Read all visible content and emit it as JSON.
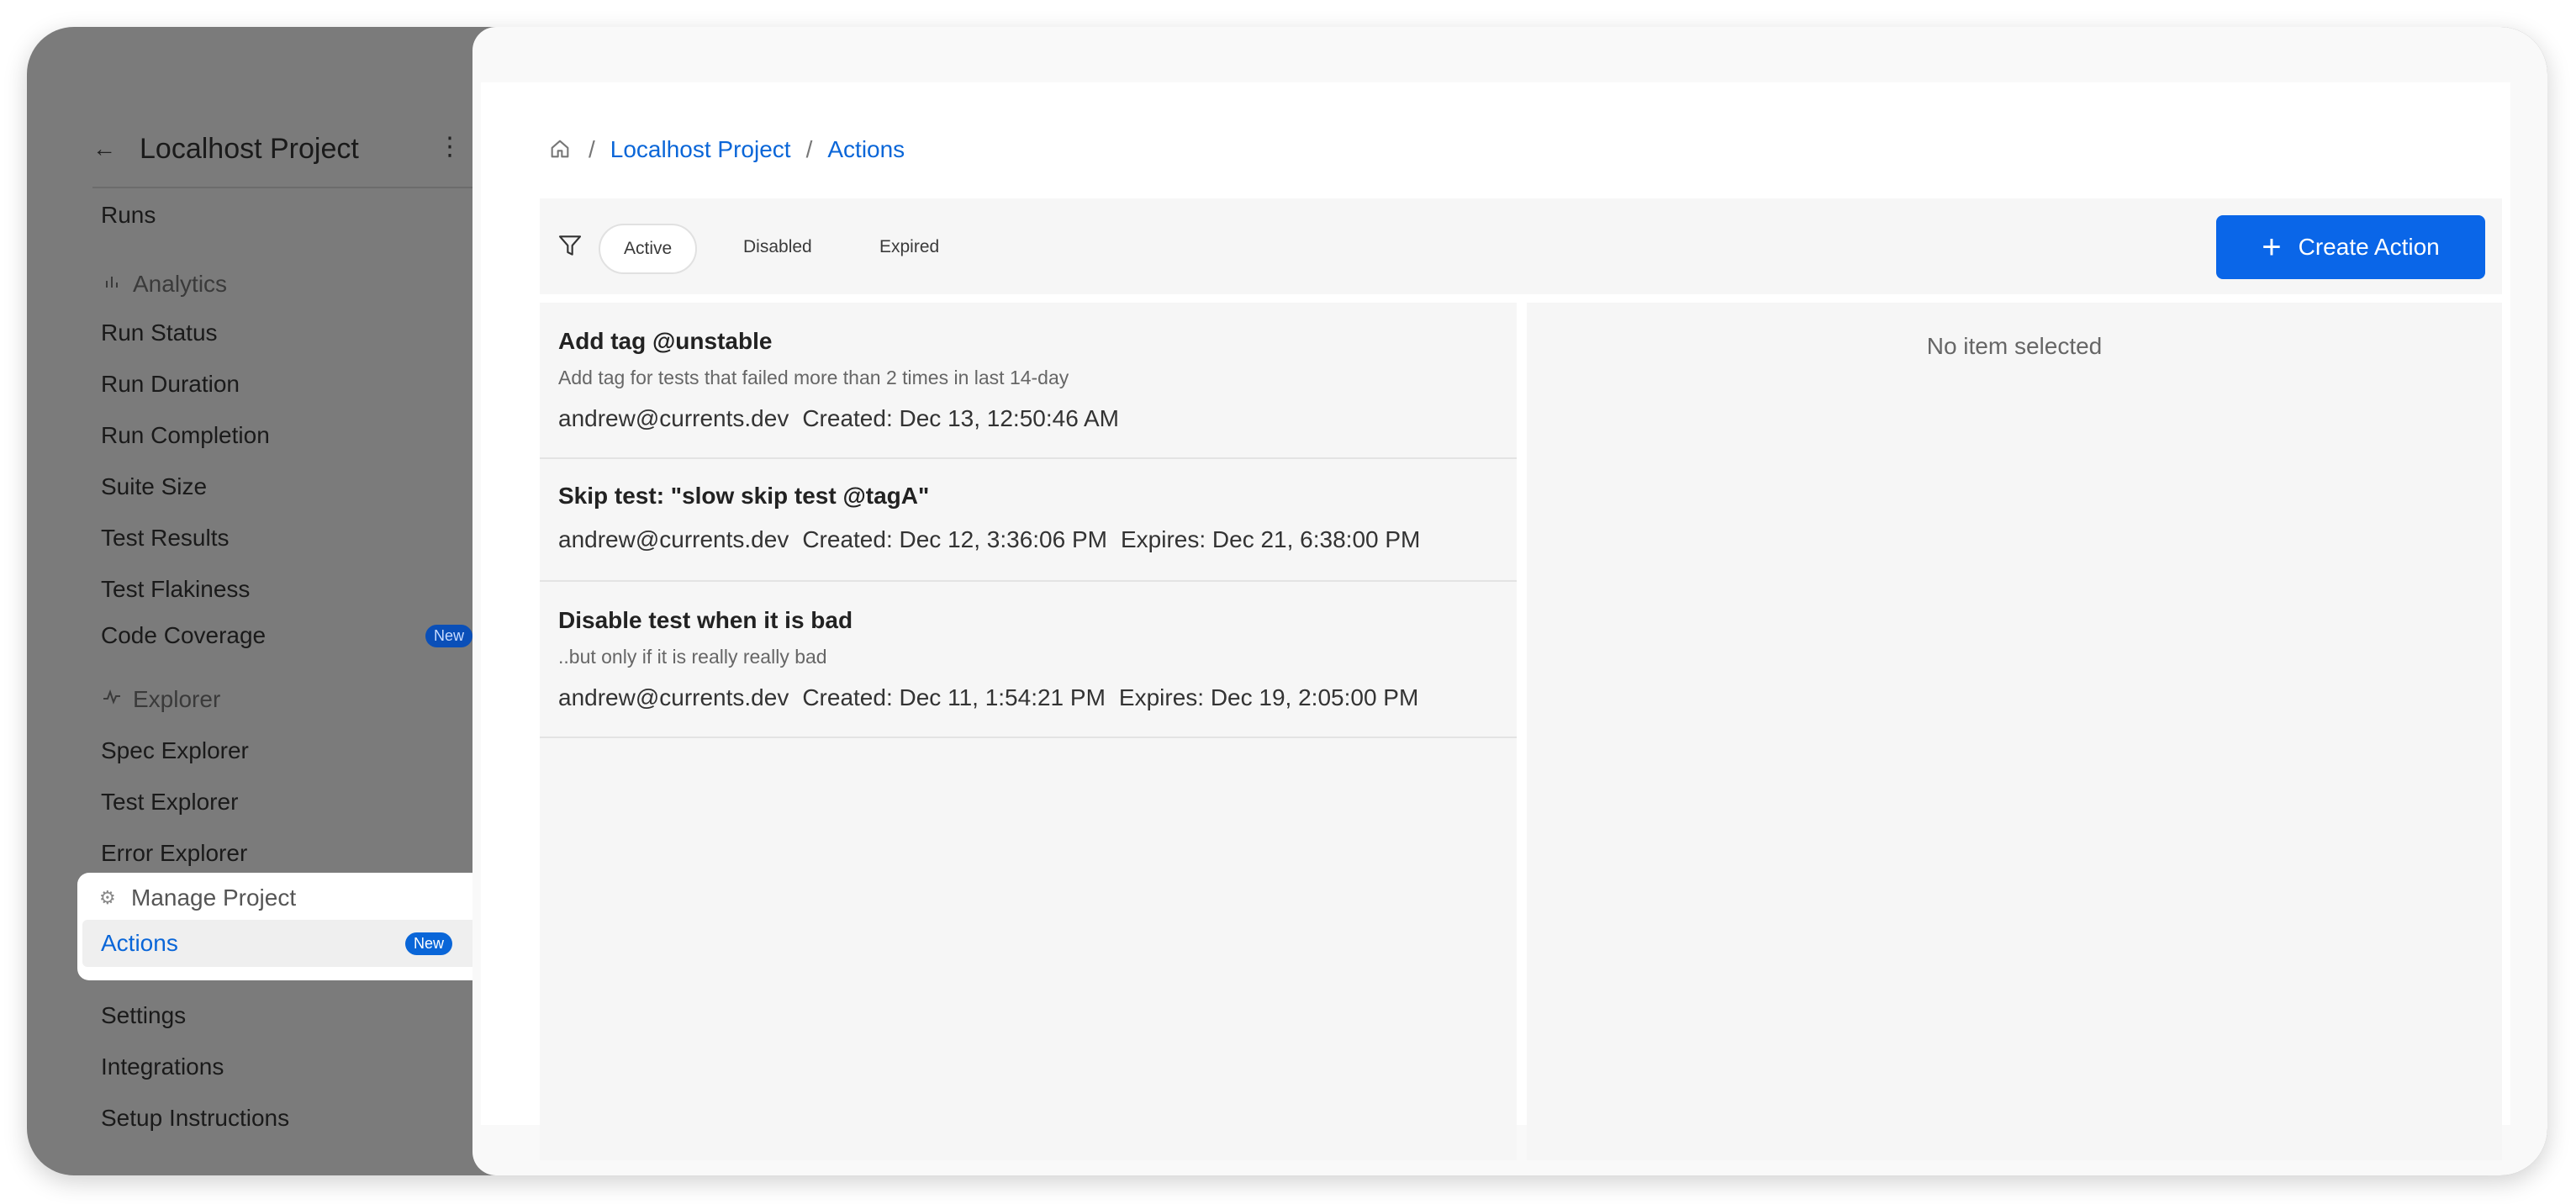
{
  "sidebar": {
    "project_title": "Localhost Project",
    "items": {
      "runs": "Runs",
      "analytics_section": "Analytics",
      "run_status": "Run Status",
      "run_duration": "Run Duration",
      "run_completion": "Run Completion",
      "suite_size": "Suite Size",
      "test_results": "Test Results",
      "test_flakiness": "Test Flakiness",
      "code_coverage": "Code Coverage",
      "code_coverage_badge": "New",
      "explorer_section": "Explorer",
      "spec_explorer": "Spec Explorer",
      "test_explorer": "Test Explorer",
      "error_explorer": "Error Explorer",
      "manage_section": "Manage Project",
      "actions": "Actions",
      "actions_badge": "New",
      "settings": "Settings",
      "integrations": "Integrations",
      "setup_instructions": "Setup Instructions"
    }
  },
  "breadcrumb": {
    "project": "Localhost Project",
    "page": "Actions"
  },
  "filters": {
    "active": "Active",
    "disabled": "Disabled",
    "expired": "Expired"
  },
  "create_button": "Create Action",
  "actions": [
    {
      "title": "Add tag @unstable",
      "description": "Add tag for tests that failed more than 2 times in last 14-day",
      "author": "andrew@currents.dev",
      "created": "Created: Dec 13, 12:50:46 AM",
      "expires": ""
    },
    {
      "title": "Skip test: \"slow skip test @tagA\"",
      "description": "",
      "author": "andrew@currents.dev",
      "created": "Created: Dec 12, 3:36:06 PM",
      "expires": "Expires: Dec 21, 6:38:00 PM"
    },
    {
      "title": "Disable test when it is bad",
      "description": "..but only if it is really really bad",
      "author": "andrew@currents.dev",
      "created": "Created: Dec 11, 1:54:21 PM",
      "expires": "Expires: Dec 19, 2:05:00 PM"
    }
  ],
  "detail": {
    "empty_text": "No item selected"
  },
  "colors": {
    "accent": "#0a66e8",
    "link": "#0a66d8",
    "sidebar_overlay": "#7b7b7b"
  }
}
